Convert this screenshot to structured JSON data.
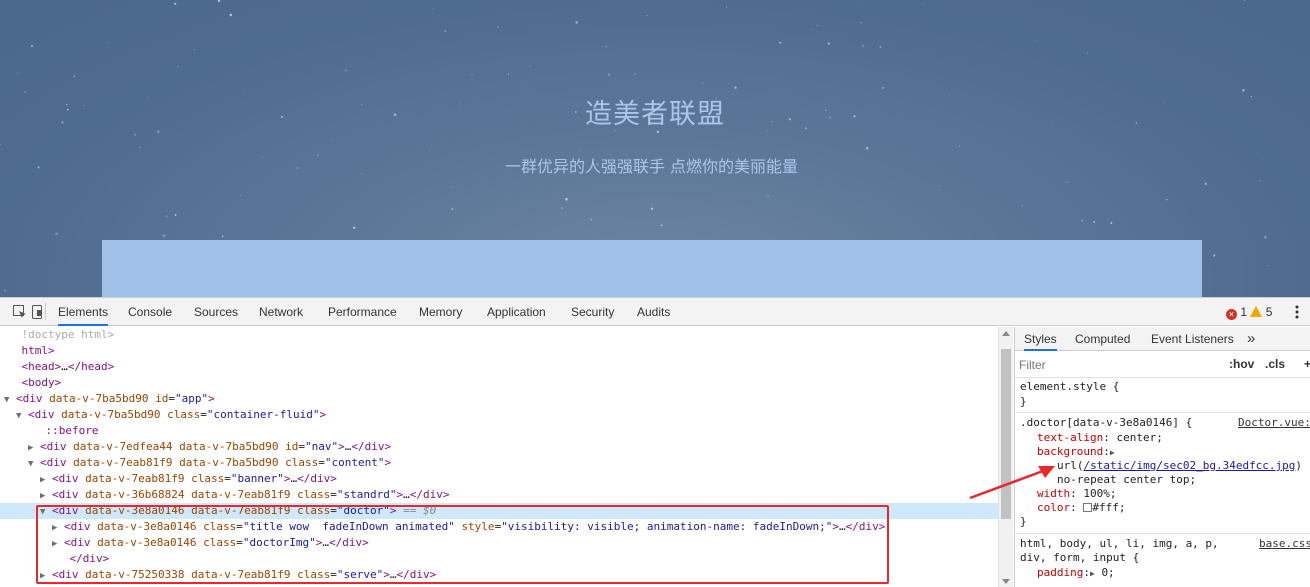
{
  "page": {
    "title": "造美者联盟",
    "subtitle": "一群优异的人强强联手 点燃你的美丽能量"
  },
  "devtools": {
    "tabs": [
      "Elements",
      "Console",
      "Sources",
      "Network",
      "Performance",
      "Memory",
      "Application",
      "Security",
      "Audits"
    ],
    "active_tab": "Elements",
    "errors": "1",
    "warnings": "5",
    "dom_lines": [
      {
        "indent": 0,
        "tri": "",
        "html": "<span class='gray'>!doctype html&gt;</span>"
      },
      {
        "indent": 0,
        "tri": "",
        "html": "<span class='t'>html&gt;</span>"
      },
      {
        "indent": 0,
        "tri": "",
        "html": "<span class='t'>&lt;head&gt;</span>…<span class='t'>&lt;/head&gt;</span>"
      },
      {
        "indent": 0,
        "tri": "",
        "html": "<span class='t'>&lt;body&gt;</span>"
      },
      {
        "indent": 0,
        "tri": "▼",
        "html": "<span class='t'>&lt;div</span> <span class='a'>data-v-7ba5bd90</span> <span class='a'>id</span>=<span class='v'>\"app\"</span><span class='t'>&gt;</span>"
      },
      {
        "indent": 1,
        "tri": "▼",
        "html": "<span class='t'>&lt;div</span> <span class='a'>data-v-7ba5bd90</span> <span class='a'>class</span>=<span class='v'>\"container-fluid\"</span><span class='t'>&gt;</span>"
      },
      {
        "indent": 2,
        "tri": "",
        "html": "<span class='p'>::before</span>"
      },
      {
        "indent": 2,
        "tri": "▶",
        "html": "<span class='t'>&lt;div</span> <span class='a'>data-v-7edfea44</span> <span class='a'>data-v-7ba5bd90</span> <span class='a'>id</span>=<span class='v'>\"nav\"</span><span class='t'>&gt;</span>…<span class='t'>&lt;/div&gt;</span>"
      },
      {
        "indent": 2,
        "tri": "▼",
        "html": "<span class='t'>&lt;div</span> <span class='a'>data-v-7eab81f9</span> <span class='a'>data-v-7ba5bd90</span> <span class='a'>class</span>=<span class='v'>\"content\"</span><span class='t'>&gt;</span>"
      },
      {
        "indent": 3,
        "tri": "▶",
        "html": "<span class='t'>&lt;div</span> <span class='a'>data-v-7eab81f9</span> <span class='a'>class</span>=<span class='v'>\"banner\"</span><span class='t'>&gt;</span>…<span class='t'>&lt;/div&gt;</span>"
      },
      {
        "indent": 3,
        "tri": "▶",
        "html": "<span class='t'>&lt;div</span> <span class='a'>data-v-36b68824</span> <span class='a'>data-v-7eab81f9</span> <span class='a'>class</span>=<span class='v'>\"standrd\"</span><span class='t'>&gt;</span>…<span class='t'>&lt;/div&gt;</span>"
      },
      {
        "indent": 3,
        "tri": "▼",
        "selected": true,
        "html": "<span class='t'>&lt;div</span> <span class='a'>data-v-3e8a0146</span> <span class='a'>data-v-7eab81f9</span> <span class='a'>class</span>=<span class='v'>\"doctor\"</span><span class='t'>&gt;</span> <span class='c'>== $0</span>"
      },
      {
        "indent": 4,
        "tri": "▶",
        "html": "<span class='t'>&lt;div</span> <span class='a'>data-v-3e8a0146</span> <span class='a'>class</span>=<span class='v'>\"title wow  fadeInDown animated\"</span> <span class='a'>style</span>=<span class='v'>\"visibility: visible; animation-name: fadeInDown;\"</span><span class='t'>&gt;</span>…<span class='t'>&lt;/div&gt;</span>"
      },
      {
        "indent": 4,
        "tri": "▶",
        "html": "<span class='t'>&lt;div</span> <span class='a'>data-v-3e8a0146</span> <span class='a'>class</span>=<span class='v'>\"doctorImg\"</span><span class='t'>&gt;</span>…<span class='t'>&lt;/div&gt;</span>"
      },
      {
        "indent": 4,
        "tri": "",
        "html": "<span class='t'>&lt;/div&gt;</span>"
      },
      {
        "indent": 3,
        "tri": "▶",
        "html": "<span class='t'>&lt;div</span> <span class='a'>data-v-75250338</span> <span class='a'>data-v-7eab81f9</span> <span class='a'>class</span>=<span class='v'>\"serve\"</span><span class='t'>&gt;</span>…<span class='t'>&lt;/div&gt;</span>"
      }
    ],
    "styles": {
      "tabs": [
        "Styles",
        "Computed",
        "Event Listeners"
      ],
      "more_tabs": "»",
      "filter_placeholder": "Filter",
      "hov": ":hov",
      "cls": ".cls",
      "add": "+",
      "element_style_open": "element.style {",
      "close_brace": "}",
      "doctor_selector": ".doctor[data-v-3e8a0146] {",
      "doctor_source": "Doctor.vue:",
      "text_align": "center;",
      "background_url": "/static/img/sec02_bg.34edfcc.jpg",
      "background_rest": "no-repeat center top;",
      "width": "100%;",
      "color": "#fff;",
      "base_selector_1": "html, body, ul, li, img, a, p,",
      "base_selector_2": "div, form, input {",
      "base_source": "base.css",
      "padding": "0;"
    }
  }
}
